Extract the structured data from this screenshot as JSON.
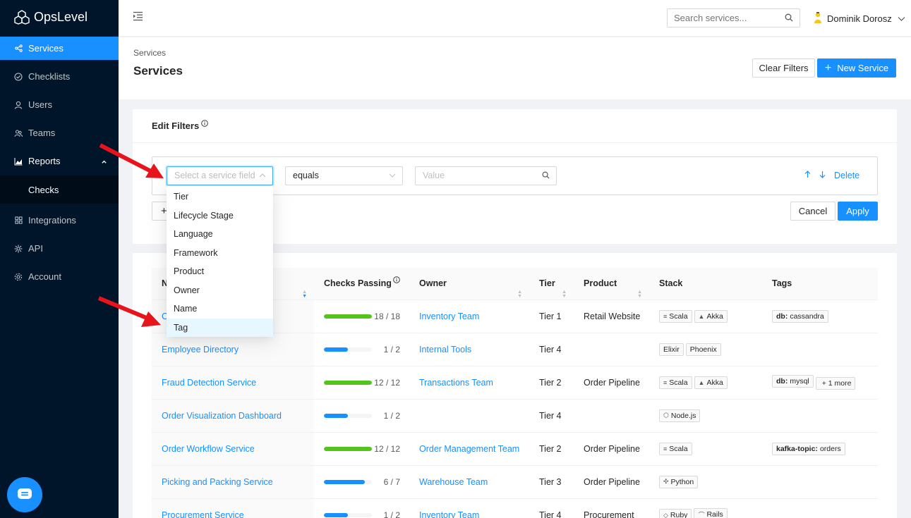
{
  "app": {
    "name": "OpsLevel"
  },
  "sidebar": {
    "items": [
      {
        "label": "Services",
        "icon": "share-nodes-icon"
      },
      {
        "label": "Checklists",
        "icon": "check-circle-icon"
      },
      {
        "label": "Users",
        "icon": "user-icon"
      },
      {
        "label": "Teams",
        "icon": "team-icon"
      },
      {
        "label": "Reports",
        "icon": "chart-icon"
      },
      {
        "label": "Checks",
        "icon": ""
      },
      {
        "label": "Integrations",
        "icon": "appstore-icon"
      },
      {
        "label": "API",
        "icon": "api-icon"
      },
      {
        "label": "Account",
        "icon": "gear-icon"
      }
    ]
  },
  "topbar": {
    "search_placeholder": "Search services...",
    "user_name": "Dominik Dorosz"
  },
  "header": {
    "breadcrumb": "Services",
    "title": "Services",
    "clear_filters": "Clear Filters",
    "new_service": "New Service"
  },
  "filters": {
    "title": "Edit Filters",
    "field_placeholder": "Select a service field",
    "operator": "equals",
    "value_placeholder": "Value",
    "delete": "Delete",
    "add": "+",
    "cancel": "Cancel",
    "apply": "Apply",
    "dropdown_options": [
      "Tier",
      "Lifecycle Stage",
      "Language",
      "Framework",
      "Product",
      "Owner",
      "Name",
      "Tag"
    ],
    "highlighted_option": "Tag"
  },
  "table": {
    "columns": [
      "N",
      "Checks Passing",
      "Owner",
      "Tier",
      "Product",
      "Stack",
      "Tags"
    ],
    "rows": [
      {
        "name": "C",
        "passed": 18,
        "total": 18,
        "checks": "18 / 18",
        "owner": "Inventory Team",
        "tier": "Tier 1",
        "product": "Retail Website",
        "stack": [
          "Scala",
          "Akka"
        ],
        "tags": [
          {
            "key": "db:",
            "value": "cassandra"
          }
        ]
      },
      {
        "name": "Employee Directory",
        "passed": 1,
        "total": 2,
        "checks": "1 / 2",
        "owner": "Internal Tools",
        "tier": "Tier 4",
        "product": "",
        "stack": [
          "Elixir",
          "Phoenix"
        ],
        "tags": []
      },
      {
        "name": "Fraud Detection Service",
        "passed": 12,
        "total": 12,
        "checks": "12 / 12",
        "owner": "Transactions Team",
        "tier": "Tier 2",
        "product": "Order Pipeline",
        "stack": [
          "Scala",
          "Akka"
        ],
        "tags": [
          {
            "key": "db:",
            "value": "mysql"
          },
          {
            "key": "",
            "value": "+ 1 more"
          }
        ]
      },
      {
        "name": "Order Visualization Dashboard",
        "passed": 1,
        "total": 2,
        "checks": "1 / 2",
        "owner": "",
        "tier": "Tier 4",
        "product": "",
        "stack": [
          "Node.js"
        ],
        "tags": []
      },
      {
        "name": "Order Workflow Service",
        "passed": 12,
        "total": 12,
        "checks": "12 / 12",
        "owner": "Order Management Team",
        "tier": "Tier 2",
        "product": "Order Pipeline",
        "stack": [
          "Scala"
        ],
        "tags": [
          {
            "key": "kafka-topic:",
            "value": "orders"
          }
        ]
      },
      {
        "name": "Picking and Packing Service",
        "passed": 6,
        "total": 7,
        "checks": "6 / 7",
        "owner": "Warehouse Team",
        "tier": "Tier 3",
        "product": "Order Pipeline",
        "stack": [
          "Python"
        ],
        "tags": []
      },
      {
        "name": "Procurement Service",
        "passed": 1,
        "total": 2,
        "checks": "1 / 2",
        "owner": "Inventory Team",
        "tier": "Tier 4",
        "product": "Procurement",
        "stack": [
          "Ruby",
          "Rails"
        ],
        "tags": []
      }
    ]
  },
  "colors": {
    "accent": "#1890ff",
    "success": "#52c41a",
    "sidebar": "#001529",
    "annotation": "#e8141b"
  }
}
